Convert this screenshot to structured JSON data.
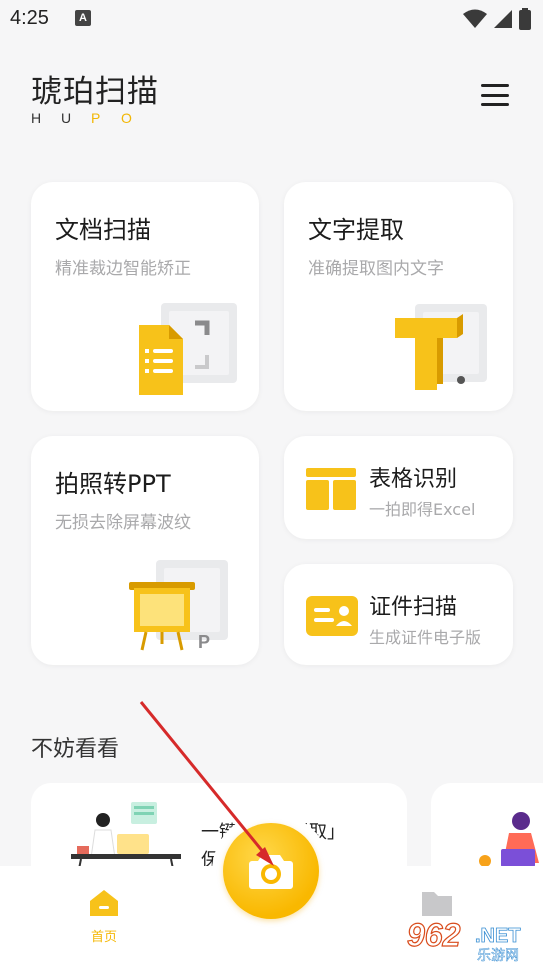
{
  "status_bar": {
    "time": "4:25",
    "notification_glyph": "A"
  },
  "header": {
    "title": "琥珀扫描",
    "subtitle_letters": [
      "H",
      "U",
      "P",
      "O"
    ],
    "menu_icon": "hamburger-menu-icon"
  },
  "cards": {
    "doc_scan": {
      "title": "文档扫描",
      "desc": "精准裁边智能矫正"
    },
    "text_extract": {
      "title": "文字提取",
      "desc": "准确提取图内文字"
    },
    "photo_ppt": {
      "title": "拍照转PPT",
      "desc": "无损去除屏幕波纹"
    },
    "table_recognize": {
      "title": "表格识别",
      "desc": "一拍即得Excel"
    },
    "id_scan": {
      "title": "证件扫描",
      "desc": "生成证件电子版"
    }
  },
  "section": {
    "title": "不妨看看"
  },
  "promo": {
    "line1": "一键「文字提取」",
    "line2": "保存"
  },
  "bottom_nav": {
    "home_label": "首页"
  },
  "watermark": {
    "text": "962.NET",
    "subtext": "乐游网"
  },
  "colors": {
    "accent": "#f9b800",
    "background": "#f6f6f7",
    "card": "#ffffff",
    "muted": "#a9a9ab"
  }
}
